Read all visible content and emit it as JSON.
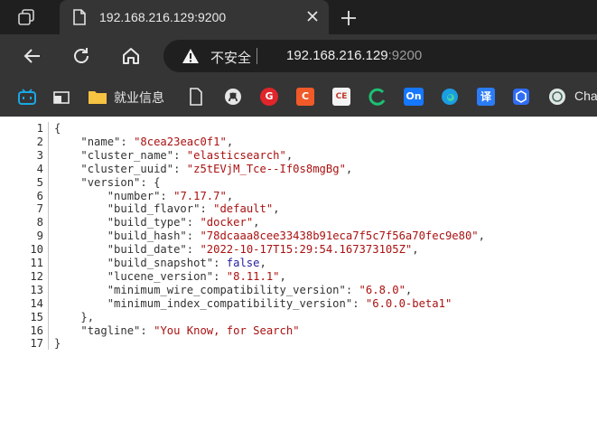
{
  "browser": {
    "tab": {
      "title": "192.168.216.129:9200"
    },
    "address": {
      "security_label": "不安全",
      "host": "192.168.216.129",
      "port": ":9200"
    },
    "bookmarks": [
      {
        "icon": "bilibili-icon",
        "label": ""
      },
      {
        "icon": "window-icon",
        "label": ""
      },
      {
        "icon": "folder-icon",
        "label": "就业信息"
      },
      {
        "icon": "document-icon",
        "label": ""
      },
      {
        "icon": "github-icon",
        "label": ""
      },
      {
        "icon": "g-red-icon",
        "label": ""
      },
      {
        "icon": "c-orange-icon",
        "label": ""
      },
      {
        "icon": "ce-icon",
        "label": ""
      },
      {
        "icon": "green-c-icon",
        "label": ""
      },
      {
        "icon": "on-icon",
        "label": "On"
      },
      {
        "icon": "edge-icon",
        "label": ""
      },
      {
        "icon": "translate-icon",
        "label": "译"
      },
      {
        "icon": "cube-icon",
        "label": ""
      },
      {
        "icon": "chatgpt-icon",
        "label": "Cha"
      }
    ]
  },
  "json": {
    "line_numbers": [
      "1",
      "2",
      "3",
      "4",
      "5",
      "6",
      "7",
      "8",
      "9",
      "10",
      "11",
      "12",
      "13",
      "14",
      "15",
      "16",
      "17"
    ],
    "name": "8cea23eac0f1",
    "cluster_name": "elasticsearch",
    "cluster_uuid": "z5tEVjM_Tce--If0s8mgBg",
    "version": {
      "number": "7.17.7",
      "build_flavor": "default",
      "build_type": "docker",
      "build_hash": "78dcaaa8cee33438b91eca7f5c7f56a70fec9e80",
      "build_date": "2022-10-17T15:29:54.167373105Z",
      "build_snapshot": "false",
      "lucene_version": "8.11.1",
      "minimum_wire_compatibility_version": "6.8.0",
      "minimum_index_compatibility_version": "6.0.0-beta1"
    },
    "tagline": "You Know, for Search"
  }
}
